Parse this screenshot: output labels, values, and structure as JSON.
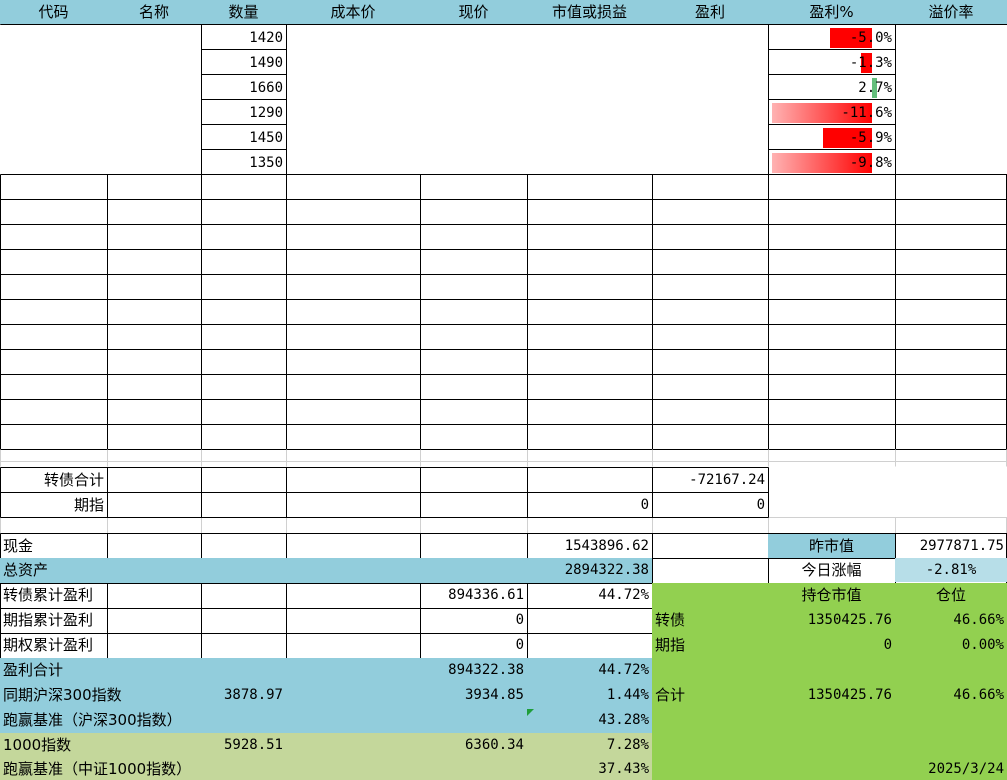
{
  "header": [
    "代码",
    "名称",
    "数量",
    "成本价",
    "现价",
    "市值或损益",
    "盈利",
    "盈利%",
    "溢价率"
  ],
  "positions": [
    {
      "qty": "1420",
      "pct_text": "-5.0%",
      "pct": -5.0
    },
    {
      "qty": "1490",
      "pct_text": "-1.3%",
      "pct": -1.3
    },
    {
      "qty": "1660",
      "pct_text": "2.7%",
      "pct": 2.7
    },
    {
      "qty": "1290",
      "pct_text": "-11.6%",
      "pct": -11.6
    },
    {
      "qty": "1450",
      "pct_text": "-5.9%",
      "pct": -5.9
    },
    {
      "qty": "1350",
      "pct_text": "-9.8%",
      "pct": -9.8
    }
  ],
  "totals": {
    "cb_total_label": "转债合计",
    "cb_total_profit": "-72167.24",
    "fut_label": "期指",
    "fut_value": "0",
    "fut_profit": "0"
  },
  "summary": {
    "cash_label": "现金",
    "cash_value": "1543896.62",
    "prev_mv_label": "昨市值",
    "prev_mv_value": "2977871.75",
    "assets_label": "总资产",
    "assets_value": "2894322.38",
    "today_chg_label": "今日涨幅",
    "today_chg_value": "-2.81%",
    "cb_cum_label": "转债累计盈利",
    "cb_cum_value": "894336.61",
    "cb_cum_pct": "44.72%",
    "hold_mv_label": "持仓市值",
    "position_label": "仓位",
    "fut_cum_label": "期指累计盈利",
    "fut_cum_value": "0",
    "cb_row_label": "转债",
    "cb_row_mv": "1350425.76",
    "cb_row_pos": "46.66%",
    "opt_cum_label": "期权累计盈利",
    "opt_cum_value": "0",
    "fut_row_label": "期指",
    "fut_row_mv": "0",
    "fut_row_pos": "0.00%",
    "profit_total_label": "盈利合计",
    "profit_total_value": "894322.38",
    "profit_total_pct": "44.72%",
    "hs300_label": "同期沪深300指数",
    "hs300_start": "3878.97",
    "hs300_now": "3934.85",
    "hs300_pct": "1.44%",
    "sum_label": "合计",
    "sum_mv": "1350425.76",
    "sum_pos": "46.66%",
    "beat300_label": "跑赢基准（沪深300指数）",
    "beat300_value": "43.28%",
    "idx1000_label": "1000指数",
    "idx1000_start": "5928.51",
    "idx1000_now": "6360.34",
    "idx1000_pct": "7.28%",
    "beat1000_label": "跑赢基准（中证1000指数）",
    "beat1000_value": "37.43%",
    "date": "2025/3/24"
  },
  "colors": {
    "header": "#92CDDC",
    "blue": "#92CDDC",
    "light_blue": "#B7DEE8",
    "green": "#92D050",
    "olive": "#C4D79B",
    "neg": "#FF0000",
    "pos": "#63BE7B"
  }
}
